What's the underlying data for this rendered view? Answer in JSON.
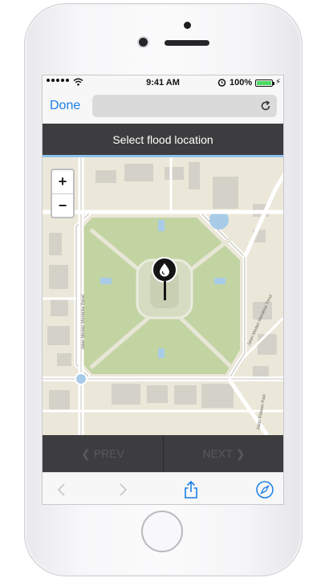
{
  "status": {
    "time": "9:41 AM",
    "battery_text": "100%",
    "battery_level": 1.0,
    "battery_color": "#4cd964"
  },
  "browser": {
    "done_label": "Done",
    "url": "",
    "reload_icon": "reload-icon"
  },
  "page": {
    "title": "Select flood location"
  },
  "map": {
    "zoom_in": "+",
    "zoom_out": "−",
    "pin_icon": "water-drop-icon",
    "street_labels": [
      "Jalan Medan Merdeka Barat",
      "Jalan Medan Merdeka Timur",
      "Jalan Ridwan Rais"
    ]
  },
  "nav": {
    "prev_label": "PREV",
    "next_label": "NEXT"
  },
  "toolbar": {
    "icons": [
      "back-icon",
      "forward-icon",
      "share-icon",
      "compass-icon"
    ]
  },
  "colors": {
    "accent": "#1a7fe6",
    "header_bg": "#3d3d3f",
    "park_green": "#c3d4a3",
    "water": "#a8cce8"
  }
}
